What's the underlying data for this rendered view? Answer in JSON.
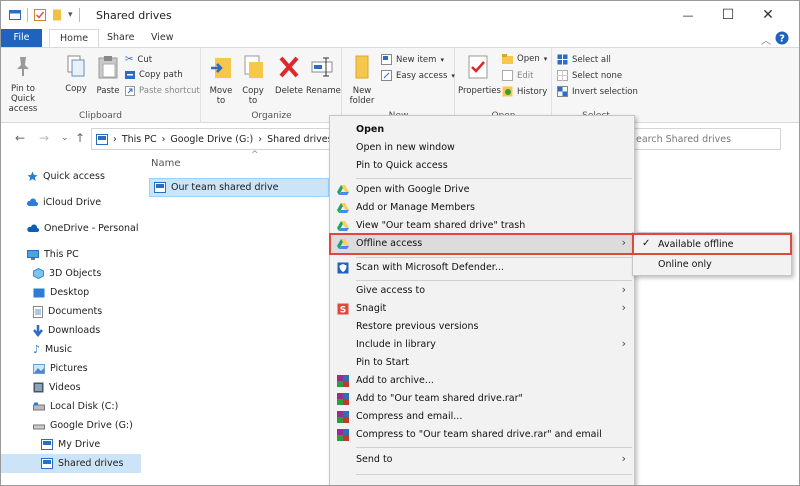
{
  "window": {
    "title": "Shared drives",
    "qat_dropdown": "▾",
    "minimize": "—",
    "maximize": "☐",
    "close": "✕"
  },
  "tabs": [
    {
      "label": "File"
    },
    {
      "label": "Home"
    },
    {
      "label": "Share"
    },
    {
      "label": "View"
    }
  ],
  "ribbon": {
    "clipboard": {
      "label": "Clipboard",
      "pin_label": "Pin to Quick access",
      "copy_label": "Copy",
      "paste_label": "Paste",
      "cut_label": "Cut",
      "copy_path_label": "Copy path",
      "paste_shortcut_label": "Paste shortcut"
    },
    "organize": {
      "label": "Organize",
      "move_label": "Move to",
      "copyto_label": "Copy to",
      "delete_label": "Delete",
      "rename_label": "Rename"
    },
    "new": {
      "label": "New",
      "newfolder_label": "New folder",
      "newitem_label": "New item",
      "easyaccess_label": "Easy access"
    },
    "open": {
      "label": "Open",
      "properties_label": "Properties",
      "open_label": "Open",
      "edit_label": "Edit",
      "history_label": "History"
    },
    "select": {
      "label": "Select",
      "selectall_label": "Select all",
      "selectnone_label": "Select none",
      "invert_label": "Invert selection"
    }
  },
  "nav": {
    "breadcrumb": [
      "This PC",
      "Google Drive (G:)",
      "Shared drives"
    ],
    "search_placeholder": "earch Shared drives"
  },
  "sidebar": {
    "items": [
      {
        "label": "Quick access"
      },
      {
        "label": "iCloud Drive"
      },
      {
        "label": "OneDrive - Personal"
      },
      {
        "label": "This PC"
      },
      {
        "label": "3D Objects"
      },
      {
        "label": "Desktop"
      },
      {
        "label": "Documents"
      },
      {
        "label": "Downloads"
      },
      {
        "label": "Music"
      },
      {
        "label": "Pictures"
      },
      {
        "label": "Videos"
      },
      {
        "label": "Local Disk (C:)"
      },
      {
        "label": "Google Drive (G:)"
      },
      {
        "label": "My Drive"
      },
      {
        "label": "Shared drives"
      }
    ]
  },
  "content": {
    "column_name": "Name",
    "file_name": "Our team shared drive"
  },
  "context_menu": {
    "items": [
      {
        "label": "Open"
      },
      {
        "label": "Open in new window"
      },
      {
        "label": "Pin to Quick access"
      },
      {
        "label": "Open with Google Drive"
      },
      {
        "label": "Add or Manage Members"
      },
      {
        "label": "View \"Our team shared drive\" trash"
      },
      {
        "label": "Offline access"
      },
      {
        "label": "Scan with Microsoft Defender..."
      },
      {
        "label": "Give access to"
      },
      {
        "label": "Snagit"
      },
      {
        "label": "Restore previous versions"
      },
      {
        "label": "Include in library"
      },
      {
        "label": "Pin to Start"
      },
      {
        "label": "Add to archive..."
      },
      {
        "label": "Add to \"Our team shared drive.rar\""
      },
      {
        "label": "Compress and email..."
      },
      {
        "label": "Compress to \"Our team shared drive.rar\" and email"
      },
      {
        "label": "Send to"
      }
    ]
  },
  "submenu": {
    "items": [
      {
        "label": "Available offline",
        "checked": true
      },
      {
        "label": "Online only",
        "checked": false
      }
    ]
  },
  "colors": {
    "accent": "#1e63bf",
    "selection": "#cce4f7",
    "highlight_border": "#e0473d",
    "google_green": "#1fa463",
    "google_yellow": "#ffd04b",
    "google_blue": "#4688f4"
  }
}
